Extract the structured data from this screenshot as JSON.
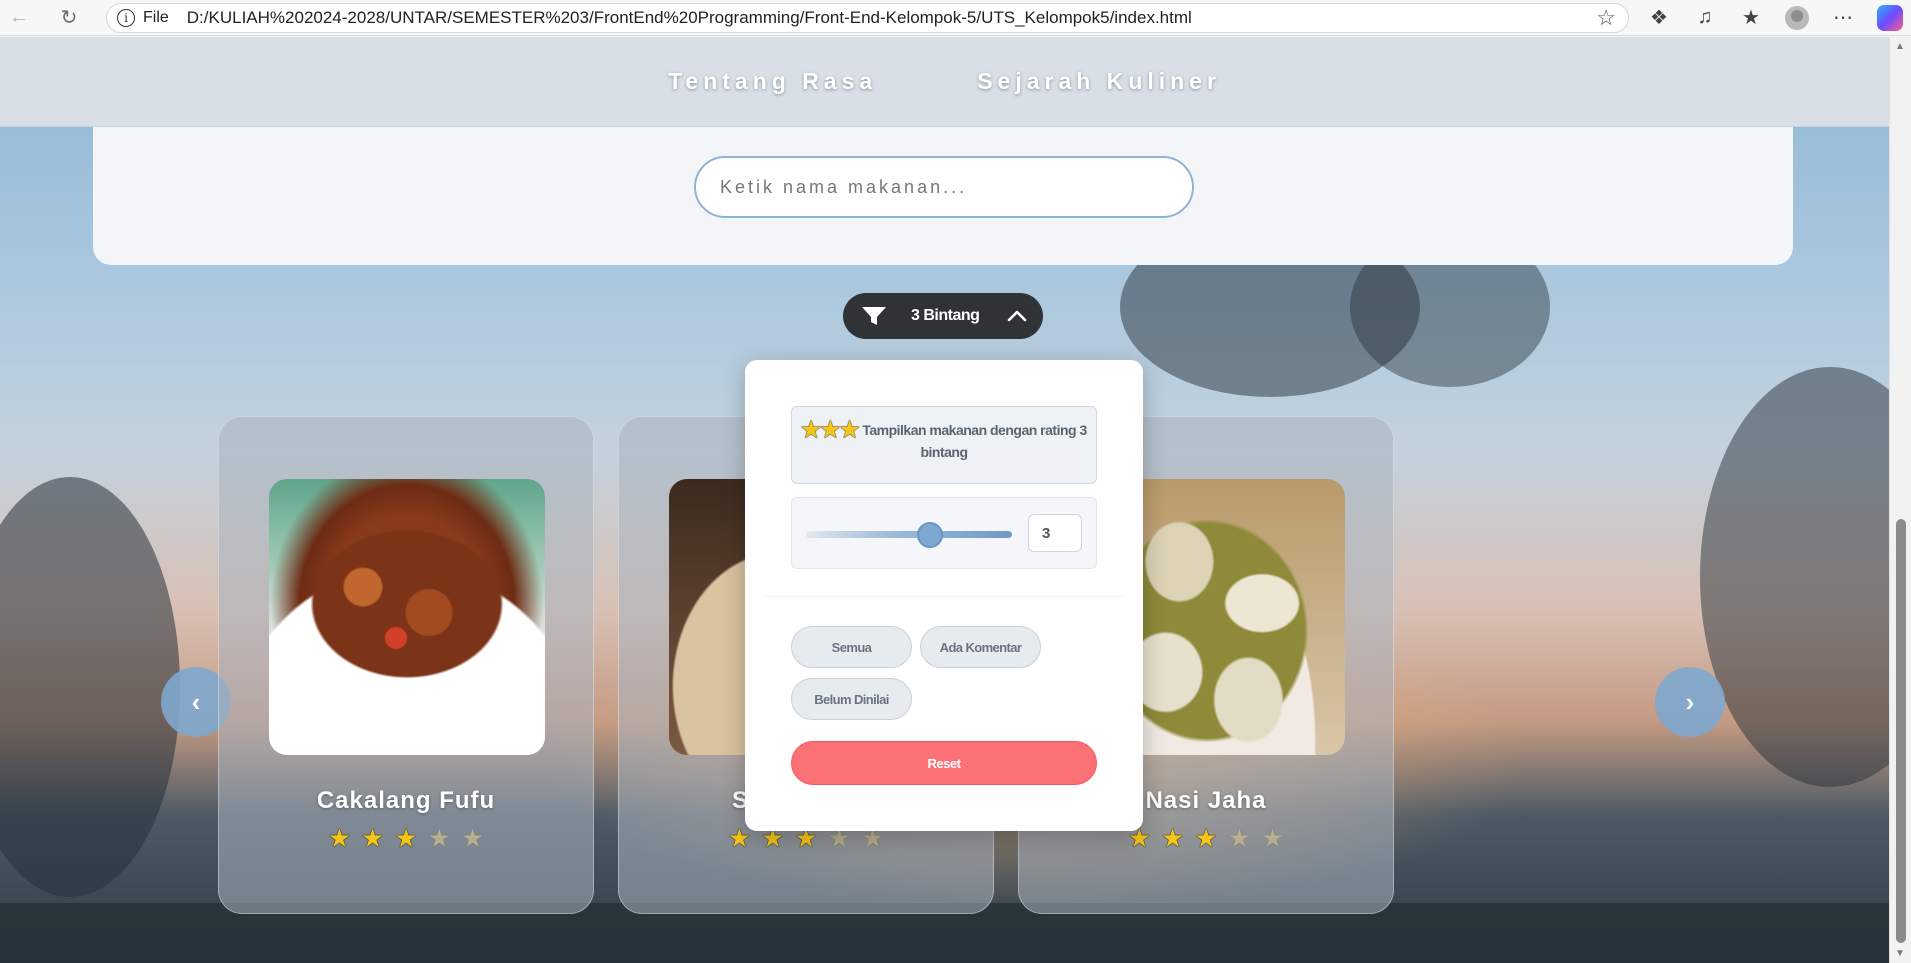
{
  "browser": {
    "protocol_label": "File",
    "url": "D:/KULIAH%202024-2028/UNTAR/SEMESTER%203/FrontEnd%20Programming/Front-End-Kelompok-5/UTS_Kelompok5/index.html"
  },
  "header": {
    "nav": [
      "Tentang Rasa",
      "Sejarah Kuliner"
    ]
  },
  "search": {
    "placeholder": "Ketik nama makanan..."
  },
  "filter": {
    "pill_label": "3 Bintang",
    "info_text": "Tampilkan makanan dengan rating 3 bintang",
    "rating_value": "3",
    "slider_min": 0,
    "slider_max": 5,
    "slider_value": 3,
    "chips": [
      "Semua",
      "Ada Komentar",
      "Belum Dinilai"
    ],
    "reset_label": "Reset"
  },
  "carousel": {
    "prev_label": "‹",
    "next_label": "›",
    "cards": [
      {
        "title": "Cakalang Fufu",
        "rating": 3,
        "max": 5
      },
      {
        "title": "S",
        "rating": 3,
        "max": 5
      },
      {
        "title": "Nasi Jaha",
        "rating": 3,
        "max": 5
      }
    ]
  },
  "colors": {
    "accent": "#7fa8d0",
    "reset": "#fb7175",
    "star_on": "#f5c518",
    "pill_bg": "#2f3336"
  }
}
